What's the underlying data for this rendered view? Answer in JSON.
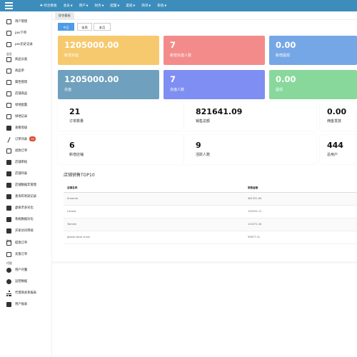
{
  "topbar": {
    "nav": [
      {
        "label": "✚ 综合看板",
        "caret": false
      },
      {
        "label": "会员",
        "caret": true
      },
      {
        "label": "用户",
        "caret": true
      },
      {
        "label": "财务",
        "caret": true
      },
      {
        "label": "配置",
        "caret": true
      },
      {
        "label": "渠道",
        "caret": true
      },
      {
        "label": "简讯",
        "caret": true
      },
      {
        "label": "系统",
        "caret": true
      }
    ]
  },
  "sidebar": {
    "items": [
      {
        "label": "用户管理",
        "icon": "book-icon"
      },
      {
        "label": "pos下单",
        "icon": "book-icon"
      },
      {
        "label": "pos历史记录",
        "icon": "book-icon"
      },
      {
        "header": "会员"
      },
      {
        "label": "商品分类",
        "icon": "laptop-icon"
      },
      {
        "label": "商品单",
        "icon": "book-icon"
      },
      {
        "label": "属性管理",
        "icon": "book-icon"
      },
      {
        "label": "店铺商品",
        "icon": "book-icon"
      },
      {
        "label": "绿地配置",
        "icon": "book-icon"
      },
      {
        "label": "绿地记录",
        "icon": "book-icon"
      },
      {
        "label": "查看等级",
        "icon": "list-icon"
      },
      {
        "label": "订单列表",
        "icon": "pencil-icon",
        "badge": "76"
      },
      {
        "label": "退款订单",
        "icon": "book-icon"
      },
      {
        "label": "店铺审核",
        "icon": "list-icon"
      },
      {
        "label": "店铺列表",
        "icon": "list-icon"
      },
      {
        "label": "店铺数据年管理",
        "icon": "list-icon"
      },
      {
        "label": "查询年利润记录",
        "icon": "list-icon"
      },
      {
        "label": "虚拟币多对比",
        "icon": "list-icon"
      },
      {
        "label": "系统数据对比",
        "icon": "list-icon"
      },
      {
        "label": "买家访问审核",
        "icon": "list-icon"
      },
      {
        "header": "财务"
      },
      {
        "label": "提现订单",
        "icon": "book-icon"
      },
      {
        "label": "充值订单",
        "icon": "book-icon"
      },
      {
        "header": "代理"
      },
      {
        "label": "用户存量",
        "icon": "pie-icon"
      },
      {
        "label": "运营数据",
        "icon": "pie-icon"
      },
      {
        "label": "代理商关系报表",
        "icon": "sitemap-icon"
      },
      {
        "label": "用户报表",
        "icon": "list-icon"
      }
    ]
  },
  "tabbar": {
    "active_tab": "综合看板"
  },
  "period": {
    "buttons": [
      "今日",
      "本周",
      "本月"
    ],
    "active": "今日"
  },
  "colors": {
    "orange": "#f7c96e",
    "red": "#f48b8b",
    "blue_light": "#75a7e6",
    "steel": "#6fa0bd",
    "indigo": "#7f8ef3",
    "green": "#88d89c",
    "accent": "#3c8dbc"
  },
  "stats_row1": [
    {
      "value": "1205000.00",
      "label": "新增充值",
      "color": "#f7c96e"
    },
    {
      "value": "7",
      "label": "新增充值人数",
      "color": "#f48b8b"
    },
    {
      "value": "0.00",
      "label": "新增提现",
      "color": "#75a7e6"
    }
  ],
  "stats_row2": [
    {
      "value": "1205000.00",
      "label": "充值",
      "color": "#6fa0bd"
    },
    {
      "value": "7",
      "label": "充值人数",
      "color": "#7f8ef3"
    },
    {
      "value": "0.00",
      "label": "提现",
      "color": "#88d89c"
    }
  ],
  "cards_row1": [
    {
      "value": "21",
      "label": "订单数量"
    },
    {
      "value": "821641.09",
      "label": "销售总额"
    },
    {
      "value": "0.00",
      "label": "佣金发放"
    }
  ],
  "cards_row2": [
    {
      "value": "6",
      "label": "新增店铺"
    },
    {
      "value": "9",
      "label": "活跃人数"
    },
    {
      "value": "444",
      "label": "总用户"
    }
  ],
  "top10": {
    "title": "店铺销售TOP10",
    "columns": [
      "店铺名称",
      "销售金额"
    ],
    "rows": [
      [
        "Amanda",
        "481351.64"
      ],
      [
        "Limbra",
        "130191.11"
      ],
      [
        "Twinkle",
        "110271.34"
      ],
      [
        "global store chain",
        "99877.01"
      ]
    ]
  }
}
